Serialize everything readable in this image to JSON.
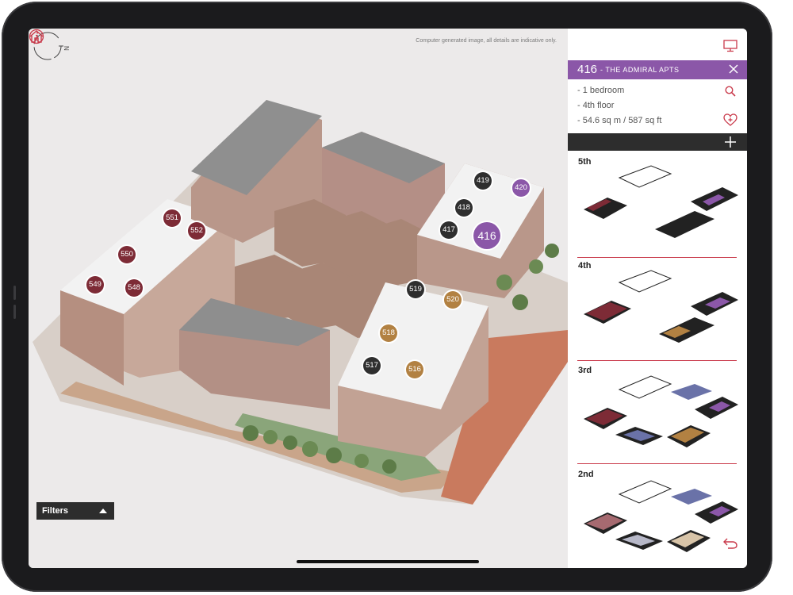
{
  "map": {
    "disclaimer": "Computer generated image, all details are indicative only.",
    "compass_letter": "N",
    "units": [
      {
        "id": "551",
        "color": "#7d2b36"
      },
      {
        "id": "552",
        "color": "#7d2b36"
      },
      {
        "id": "550",
        "color": "#7d2b36"
      },
      {
        "id": "549",
        "color": "#7d2b36"
      },
      {
        "id": "548",
        "color": "#7d2b36"
      },
      {
        "id": "419",
        "color": "#2f2f2f"
      },
      {
        "id": "420",
        "color": "#8b57a8"
      },
      {
        "id": "418",
        "color": "#2f2f2f"
      },
      {
        "id": "417",
        "color": "#2f2f2f"
      },
      {
        "id": "416",
        "color": "#8b57a8"
      },
      {
        "id": "519",
        "color": "#2f2f2f"
      },
      {
        "id": "520",
        "color": "#b28142"
      },
      {
        "id": "518",
        "color": "#b28142"
      },
      {
        "id": "517",
        "color": "#2f2f2f"
      },
      {
        "id": "516",
        "color": "#b28142"
      }
    ],
    "filters_label": "Filters"
  },
  "panel": {
    "unit_number": "416",
    "unit_name": "- THE ADMIRAL APTS",
    "details": [
      "- 1 bedroom",
      "- 4th floor",
      "- 54.6 sq m / 587 sq ft"
    ],
    "floors": [
      "5th",
      "4th",
      "3rd",
      "2nd"
    ]
  },
  "colors": {
    "accent_purple": "#8b57a8",
    "accent_red": "#c9394a",
    "burgundy": "#7d2b36",
    "gold": "#b28142",
    "dark": "#2d2d2d"
  }
}
